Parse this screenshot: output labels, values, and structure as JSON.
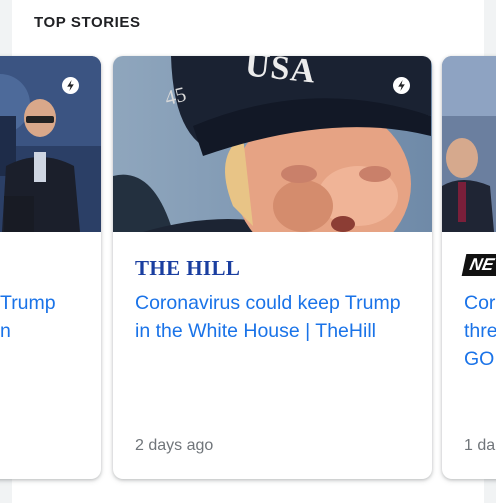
{
  "section": {
    "title": "TOP STORIES"
  },
  "cards": [
    {
      "headline_fragment": "Trump\nn"
    },
    {
      "publisher": "THE HILL",
      "headline": "Coronavirus could keep Trump in the White House | TheHill",
      "time": "2 days ago",
      "photo_caption_text": "USA",
      "photo_cap_number": "45"
    },
    {
      "publisher_fragment": "NE",
      "headline_fragment": "Cor\nthre\nGO",
      "time_fragment": "1 da"
    }
  ],
  "icons": {
    "amp_badge": "lightning-bolt-icon"
  },
  "colors": {
    "headline": "#1a73e8",
    "publisher": "#1a3ea0",
    "time": "#70757a"
  }
}
